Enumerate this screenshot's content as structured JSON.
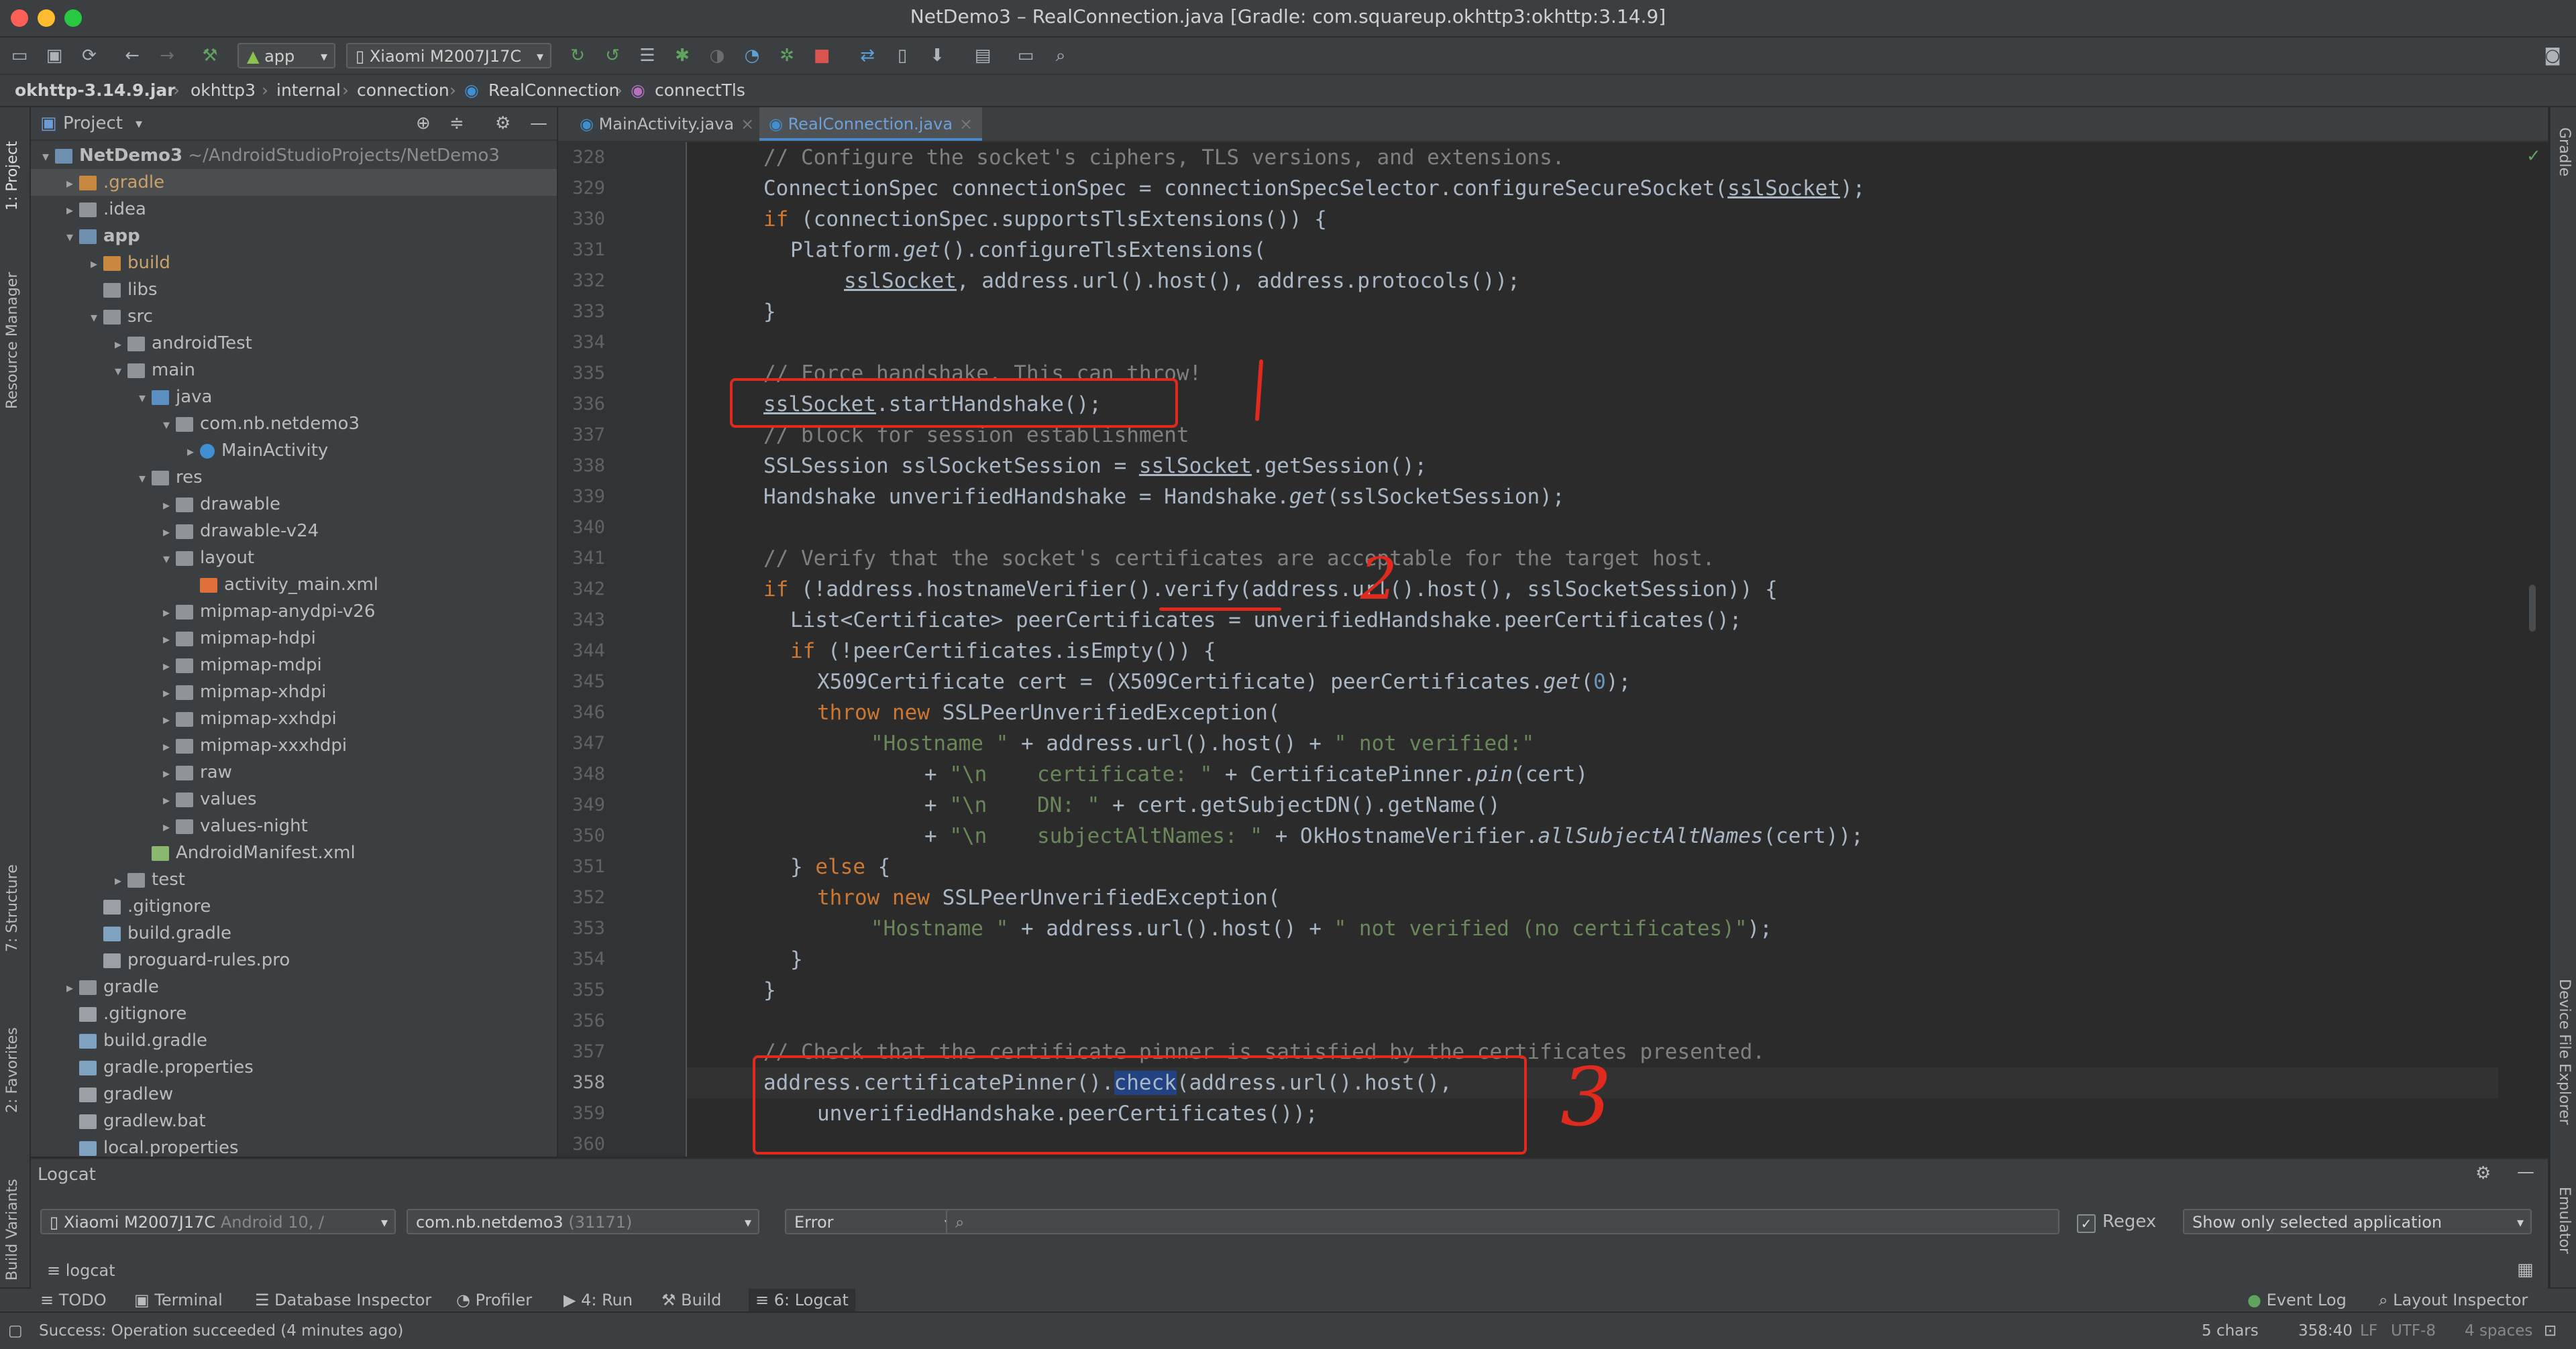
{
  "window": {
    "title": "NetDemo3 – RealConnection.java [Gradle: com.squareup.okhttp3:okhttp:3.14.9]"
  },
  "toolbar": {
    "config": "app",
    "device": "Xiaomi M2007J17C"
  },
  "breadcrumbs": [
    "okhttp-3.14.9.jar",
    "okhttp3",
    "internal",
    "connection",
    "RealConnection",
    "connectTls"
  ],
  "left_strip": {
    "project": "1: Project",
    "resource_manager": "Resource Manager",
    "structure": "7: Structure",
    "favorites": "2: Favorites",
    "build_variants": "Build Variants"
  },
  "right_strip": {
    "gradle": "Gradle",
    "device_file_explorer": "Device File Explorer",
    "emulator": "Emulator"
  },
  "project_panel": {
    "title": "Project",
    "tree": [
      {
        "label": "NetDemo3",
        "suffix": "~/AndroidStudioProjects/NetDemo3",
        "depth": 0,
        "open": true,
        "icon": "module",
        "bold": true
      },
      {
        "label": ".gradle",
        "depth": 1,
        "open": false,
        "icon": "folder-orange",
        "selected": true
      },
      {
        "label": ".idea",
        "depth": 1,
        "open": false,
        "icon": "folder"
      },
      {
        "label": "app",
        "depth": 1,
        "open": true,
        "icon": "module",
        "bold": true
      },
      {
        "label": "build",
        "depth": 2,
        "open": false,
        "icon": "folder-orange"
      },
      {
        "label": "libs",
        "depth": 2,
        "icon": "folder",
        "leaf": true
      },
      {
        "label": "src",
        "depth": 2,
        "open": true,
        "icon": "folder"
      },
      {
        "label": "androidTest",
        "depth": 3,
        "open": false,
        "icon": "folder"
      },
      {
        "label": "main",
        "depth": 3,
        "open": true,
        "icon": "folder"
      },
      {
        "label": "java",
        "depth": 4,
        "open": true,
        "icon": "folder-blue"
      },
      {
        "label": "com.nb.netdemo3",
        "depth": 5,
        "open": true,
        "icon": "package"
      },
      {
        "label": "MainActivity",
        "depth": 6,
        "open": false,
        "icon": "class"
      },
      {
        "label": "res",
        "depth": 4,
        "open": true,
        "icon": "folder-res"
      },
      {
        "label": "drawable",
        "depth": 5,
        "open": false,
        "icon": "folder"
      },
      {
        "label": "drawable-v24",
        "depth": 5,
        "open": false,
        "icon": "folder"
      },
      {
        "label": "layout",
        "depth": 5,
        "open": true,
        "icon": "folder"
      },
      {
        "label": "activity_main.xml",
        "depth": 6,
        "icon": "xml",
        "leaf": true
      },
      {
        "label": "mipmap-anydpi-v26",
        "depth": 5,
        "open": false,
        "icon": "folder"
      },
      {
        "label": "mipmap-hdpi",
        "depth": 5,
        "open": false,
        "icon": "folder"
      },
      {
        "label": "mipmap-mdpi",
        "depth": 5,
        "open": false,
        "icon": "folder"
      },
      {
        "label": "mipmap-xhdpi",
        "depth": 5,
        "open": false,
        "icon": "folder"
      },
      {
        "label": "mipmap-xxhdpi",
        "depth": 5,
        "open": false,
        "icon": "folder"
      },
      {
        "label": "mipmap-xxxhdpi",
        "depth": 5,
        "open": false,
        "icon": "folder"
      },
      {
        "label": "raw",
        "depth": 5,
        "open": false,
        "icon": "folder"
      },
      {
        "label": "values",
        "depth": 5,
        "open": false,
        "icon": "folder"
      },
      {
        "label": "values-night",
        "depth": 5,
        "open": false,
        "icon": "folder"
      },
      {
        "label": "AndroidManifest.xml",
        "depth": 4,
        "icon": "manifest",
        "leaf": true
      },
      {
        "label": "test",
        "depth": 3,
        "open": false,
        "icon": "folder"
      },
      {
        "label": ".gitignore",
        "depth": 2,
        "icon": "file",
        "leaf": true
      },
      {
        "label": "build.gradle",
        "depth": 2,
        "icon": "gradle",
        "leaf": true
      },
      {
        "label": "proguard-rules.pro",
        "depth": 2,
        "icon": "file",
        "leaf": true
      },
      {
        "label": "gradle",
        "depth": 1,
        "open": false,
        "icon": "folder"
      },
      {
        "label": ".gitignore",
        "depth": 1,
        "icon": "file",
        "leaf": true
      },
      {
        "label": "build.gradle",
        "depth": 1,
        "icon": "gradle",
        "leaf": true
      },
      {
        "label": "gradle.properties",
        "depth": 1,
        "icon": "gradle",
        "leaf": true
      },
      {
        "label": "gradlew",
        "depth": 1,
        "icon": "file",
        "leaf": true
      },
      {
        "label": "gradlew.bat",
        "depth": 1,
        "icon": "file",
        "leaf": true
      },
      {
        "label": "local.properties",
        "depth": 1,
        "icon": "gradle",
        "leaf": true
      }
    ]
  },
  "editor": {
    "tabs": [
      {
        "label": "MainActivity.java",
        "active": false
      },
      {
        "label": "RealConnection.java",
        "active": true
      }
    ],
    "current_line": 358,
    "lines": [
      {
        "n": 328,
        "text": "// Configure the socket's ciphers, TLS versions, and extensions.",
        "indent": 0,
        "kind": "comment"
      },
      {
        "n": 329,
        "text": "ConnectionSpec connectionSpec = connectionSpecSelector.configureSecureSocket(sslSocket);",
        "indent": 0
      },
      {
        "n": 330,
        "text": "if (connectionSpec.supportsTlsExtensions()) {",
        "indent": 0
      },
      {
        "n": 331,
        "text": "Platform.get().configureTlsExtensions(",
        "indent": 1
      },
      {
        "n": 332,
        "text": "sslSocket, address.url().host(), address.protocols());",
        "indent": 3
      },
      {
        "n": 333,
        "text": "}",
        "indent": 0
      },
      {
        "n": 334,
        "text": "",
        "indent": 0
      },
      {
        "n": 335,
        "text": "// Force handshake. This can throw!",
        "indent": 0,
        "kind": "comment"
      },
      {
        "n": 336,
        "text": "sslSocket.startHandshake();",
        "indent": 0
      },
      {
        "n": 337,
        "text": "// block for session establishment",
        "indent": 0,
        "kind": "comment"
      },
      {
        "n": 338,
        "text": "SSLSession sslSocketSession = sslSocket.getSession();",
        "indent": 0
      },
      {
        "n": 339,
        "text": "Handshake unverifiedHandshake = Handshake.get(sslSocketSession);",
        "indent": 0
      },
      {
        "n": 340,
        "text": "",
        "indent": 0
      },
      {
        "n": 341,
        "text": "// Verify that the socket's certificates are acceptable for the target host.",
        "indent": 0,
        "kind": "comment"
      },
      {
        "n": 342,
        "text": "if (!address.hostnameVerifier().verify(address.url().host(), sslSocketSession)) {",
        "indent": 0
      },
      {
        "n": 343,
        "text": "List<Certificate> peerCertificates = unverifiedHandshake.peerCertificates();",
        "indent": 1
      },
      {
        "n": 344,
        "text": "if (!peerCertificates.isEmpty()) {",
        "indent": 1
      },
      {
        "n": 345,
        "text": "X509Certificate cert = (X509Certificate) peerCertificates.get(0);",
        "indent": 2
      },
      {
        "n": 346,
        "text": "throw new SSLPeerUnverifiedException(",
        "indent": 2
      },
      {
        "n": 347,
        "text": "\"Hostname \" + address.url().host() + \" not verified:\"",
        "indent": 4
      },
      {
        "n": 348,
        "text": "+ \"\\n    certificate: \" + CertificatePinner.pin(cert)",
        "indent": 6
      },
      {
        "n": 349,
        "text": "+ \"\\n    DN: \" + cert.getSubjectDN().getName()",
        "indent": 6
      },
      {
        "n": 350,
        "text": "+ \"\\n    subjectAltNames: \" + OkHostnameVerifier.allSubjectAltNames(cert));",
        "indent": 6
      },
      {
        "n": 351,
        "text": "} else {",
        "indent": 1
      },
      {
        "n": 352,
        "text": "throw new SSLPeerUnverifiedException(",
        "indent": 2
      },
      {
        "n": 353,
        "text": "\"Hostname \" + address.url().host() + \" not verified (no certificates)\");",
        "indent": 4
      },
      {
        "n": 354,
        "text": "}",
        "indent": 1
      },
      {
        "n": 355,
        "text": "}",
        "indent": 0
      },
      {
        "n": 356,
        "text": "",
        "indent": 0
      },
      {
        "n": 357,
        "text": "// Check that the certificate pinner is satisfied by the certificates presented.",
        "indent": 0,
        "kind": "comment"
      },
      {
        "n": 358,
        "text": "address.certificatePinner().check(address.url().host(),",
        "indent": 0
      },
      {
        "n": 359,
        "text": "unverifiedHandshake.peerCertificates());",
        "indent": 2
      },
      {
        "n": 360,
        "text": "",
        "indent": 0
      }
    ],
    "annotations": {
      "mark1": "|",
      "mark2": "2",
      "mark3": "3"
    }
  },
  "logcat": {
    "title": "Logcat",
    "device": "Xiaomi M2007J17C",
    "device_suffix": "Android 10, /",
    "process": "com.nb.netdemo3",
    "pid": "(31171)",
    "level": "Error",
    "search_placeholder": "",
    "regex_label": "Regex",
    "regex_checked": true,
    "filter": "Show only selected application",
    "sub_tab": "logcat"
  },
  "bottom_tabs": [
    "TODO",
    "Terminal",
    "Database Inspector",
    "Profiler",
    "4: Run",
    "Build",
    "6: Logcat"
  ],
  "bottom_right_tabs": [
    "Event Log",
    "Layout Inspector"
  ],
  "status": {
    "message": "Success: Operation succeeded (4 minutes ago)",
    "chars": "5 chars",
    "position": "358:40",
    "line_sep": "LF",
    "encoding": "UTF-8",
    "indent": "4 spaces"
  },
  "colors": {
    "accent": "#4a88c7",
    "annotation": "#e02a1e",
    "comment": "#808080",
    "keyword": "#cc7832",
    "string": "#6a8759",
    "number": "#6897bb"
  }
}
